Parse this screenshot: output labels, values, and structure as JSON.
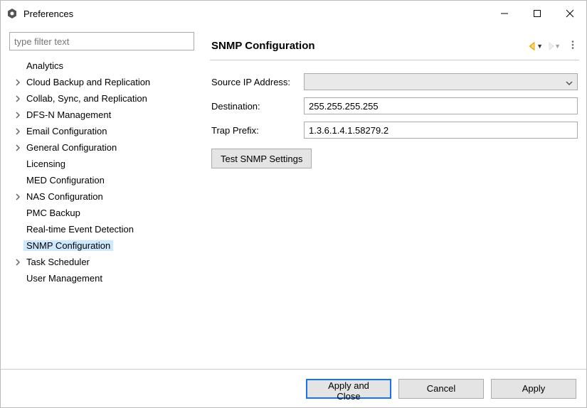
{
  "window": {
    "title": "Preferences"
  },
  "sidebar": {
    "filterPlaceholder": "type filter text",
    "items": [
      {
        "label": "Analytics",
        "expandable": false
      },
      {
        "label": "Cloud Backup and Replication",
        "expandable": true
      },
      {
        "label": "Collab, Sync, and Replication",
        "expandable": true
      },
      {
        "label": "DFS-N Management",
        "expandable": true
      },
      {
        "label": "Email Configuration",
        "expandable": true
      },
      {
        "label": "General Configuration",
        "expandable": true
      },
      {
        "label": "Licensing",
        "expandable": false
      },
      {
        "label": "MED Configuration",
        "expandable": false
      },
      {
        "label": "NAS Configuration",
        "expandable": true
      },
      {
        "label": "PMC Backup",
        "expandable": false
      },
      {
        "label": "Real-time Event Detection",
        "expandable": false
      },
      {
        "label": "SNMP Configuration",
        "expandable": false,
        "selected": true
      },
      {
        "label": "Task Scheduler",
        "expandable": true
      },
      {
        "label": "User Management",
        "expandable": false
      }
    ]
  },
  "main": {
    "title": "SNMP Configuration",
    "form": {
      "sourceIpLabel": "Source IP Address:",
      "sourceIpValue": "",
      "destinationLabel": "Destination:",
      "destinationValue": "255.255.255.255",
      "trapPrefixLabel": "Trap Prefix:",
      "trapPrefixValue": "1.3.6.1.4.1.58279.2",
      "testButton": "Test SNMP Settings"
    }
  },
  "footer": {
    "applyClose": "Apply and Close",
    "cancel": "Cancel",
    "apply": "Apply"
  }
}
